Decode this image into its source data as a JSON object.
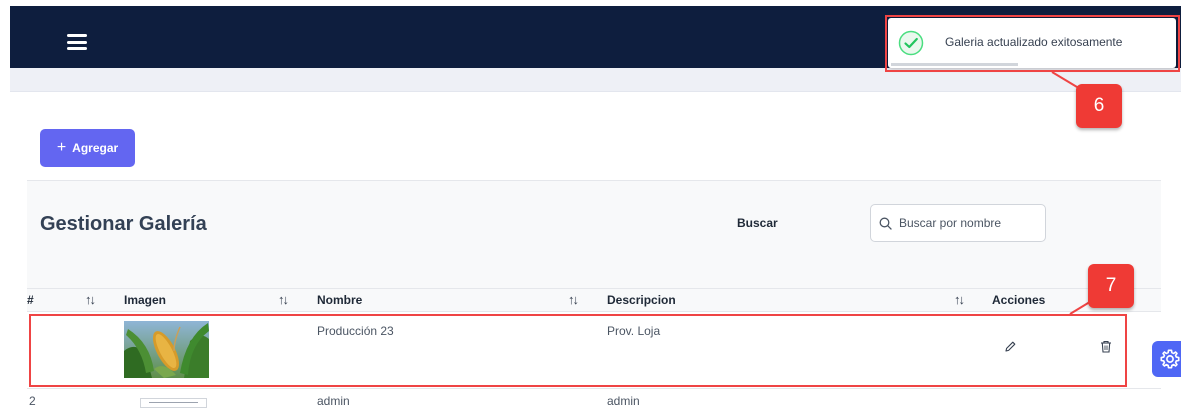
{
  "topbar": {
    "menu_icon": "hamburger-menu-icon",
    "color": "#0e1e3e"
  },
  "toolbar": {
    "add_label": "Agregar",
    "add_icon": "plus-icon",
    "accent": "#6366f1"
  },
  "page": {
    "title": "Gestionar Galería"
  },
  "search": {
    "label": "Buscar",
    "placeholder": "Buscar por nombre",
    "value": "",
    "icon": "search-icon"
  },
  "table": {
    "columns": [
      {
        "key": "index",
        "label": "#"
      },
      {
        "key": "image",
        "label": "Imagen"
      },
      {
        "key": "name",
        "label": "Nombre"
      },
      {
        "key": "description",
        "label": "Descripcion"
      },
      {
        "key": "actions",
        "label": "Acciones"
      }
    ],
    "sort_icon": "sort-arrows-icon",
    "rows": [
      {
        "index": "",
        "image": "corn-thumbnail",
        "name": "Producción 23",
        "description": "Prov. Loja",
        "actions": [
          "pencil-icon",
          "trash-icon"
        ]
      },
      {
        "index": "2",
        "image": "document-thumbnail",
        "name": "admin",
        "description": "admin",
        "actions": []
      }
    ]
  },
  "toast": {
    "message": "Galeria actualizado exitosamente",
    "icon": "check-circle-icon",
    "status_color": "#22c55e",
    "progress": 0.45
  },
  "settings_fab": {
    "icon": "gear-icon",
    "color": "#4f67f5"
  },
  "callouts": [
    {
      "number": "6",
      "color": "#ef3a35"
    },
    {
      "number": "7",
      "color": "#ef3a35"
    }
  ]
}
